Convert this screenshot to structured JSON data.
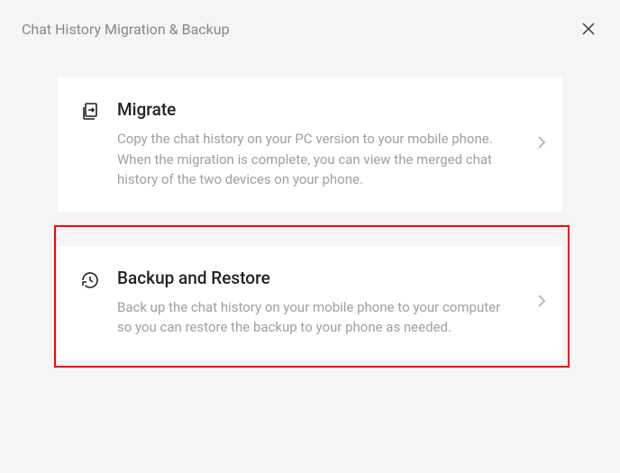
{
  "header": {
    "title": "Chat History Migration & Backup"
  },
  "cards": {
    "migrate": {
      "title": "Migrate",
      "desc": "Copy the chat history on your PC version to your mobile phone. When the migration is complete, you can view the merged chat history of the two devices on your phone."
    },
    "backup": {
      "title": "Backup and Restore",
      "desc": "Back up the chat history on your mobile phone to your computer so you can restore the backup to your phone as needed."
    }
  }
}
